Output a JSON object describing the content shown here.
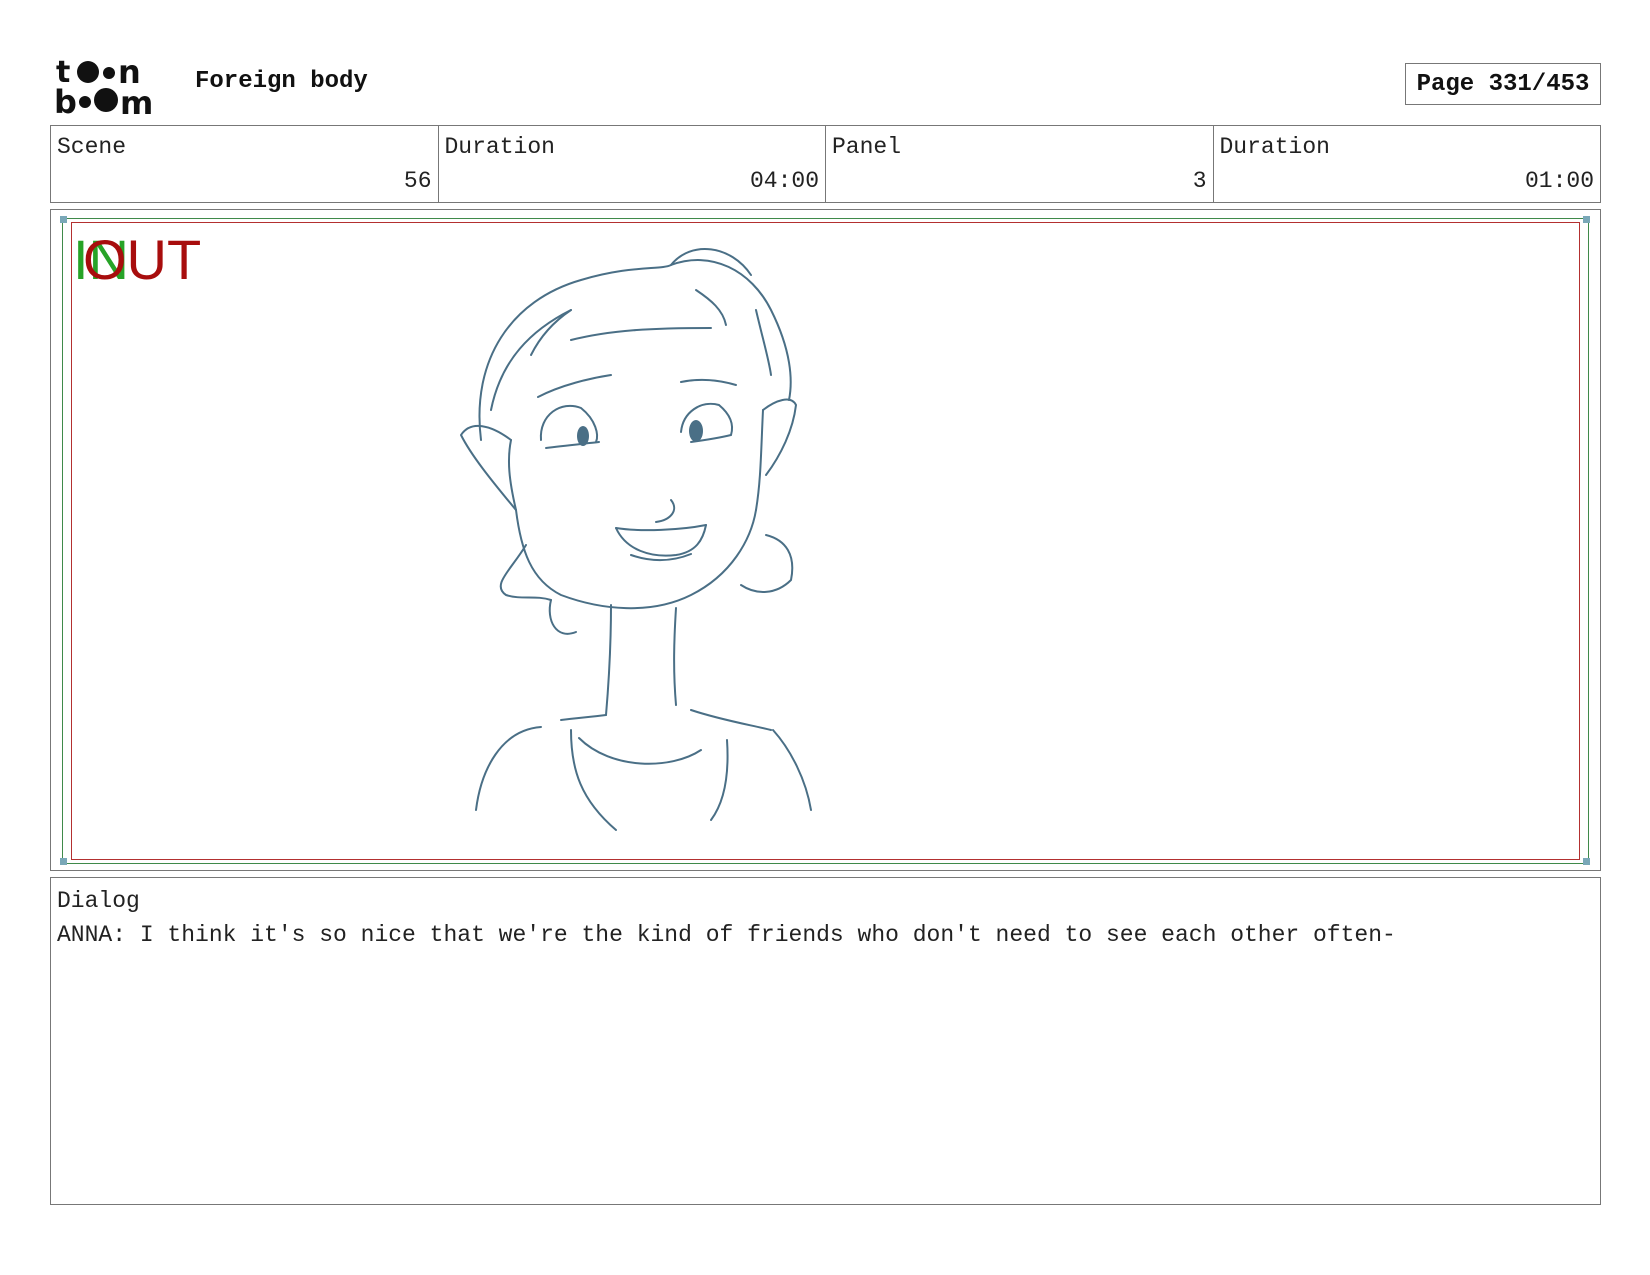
{
  "header": {
    "logo_text_top": "toon",
    "logo_text_bottom": "boom",
    "project_title": "Foreign body",
    "page_label": "Page 331/453"
  },
  "info": {
    "scene_label": "Scene",
    "scene_value": "56",
    "scene_duration_label": "Duration",
    "scene_duration_value": "04:00",
    "panel_label": "Panel",
    "panel_value": "3",
    "panel_duration_label": "Duration",
    "panel_duration_value": "01:00"
  },
  "panel": {
    "in_mark": "IN",
    "out_mark": "OUT",
    "colors": {
      "in": "#27a327",
      "out": "#a80d0d",
      "sketch": "#4a6f86"
    }
  },
  "dialog": {
    "label": "Dialog",
    "text": "ANNA: I think it's so nice that we're the kind of friends who don't need to see each other often-"
  }
}
